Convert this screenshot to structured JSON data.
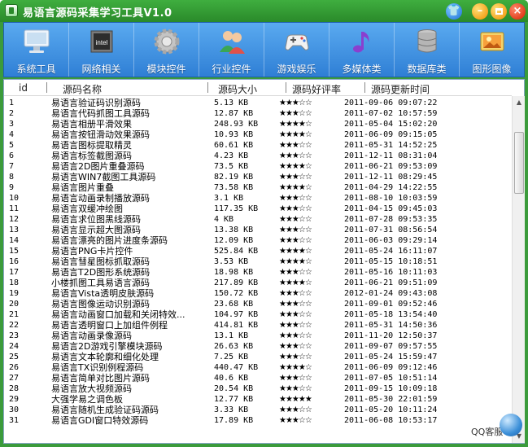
{
  "window": {
    "title": "易语言源码采集学习工具V1.0"
  },
  "colors": {
    "titlebar": "#2f9a2f",
    "toolbar": "#3a8ae0",
    "star": "#000000"
  },
  "toolbar": {
    "items": [
      {
        "label": "系统工具",
        "icon": "monitor-icon"
      },
      {
        "label": "网络相关",
        "icon": "intel-chip-icon"
      },
      {
        "label": "模块控件",
        "icon": "gear-icon"
      },
      {
        "label": "行业控件",
        "icon": "users-icon"
      },
      {
        "label": "游戏娱乐",
        "icon": "gamepad-icon"
      },
      {
        "label": "多媒体类",
        "icon": "music-note-icon"
      },
      {
        "label": "数据库类",
        "icon": "database-icon"
      },
      {
        "label": "图形图像",
        "icon": "image-icon"
      }
    ]
  },
  "table": {
    "headers": [
      "id",
      "源码名称",
      "源码大小",
      "源码好评率",
      "源码更新时间"
    ],
    "rows": [
      {
        "id": "1",
        "name": "易语言验证码识别源码",
        "size": "5.13 KB",
        "stars": 3,
        "date": "2011-09-06 09:07:22"
      },
      {
        "id": "2",
        "name": "易语言代码抓图工具源码",
        "size": "12.87 KB",
        "stars": 3,
        "date": "2011-07-02 10:57:59"
      },
      {
        "id": "3",
        "name": "易语言相册平滑效果",
        "size": "248.93 KB",
        "stars": 4,
        "date": "2011-05-04 15:02:20"
      },
      {
        "id": "4",
        "name": "易语言按钮滑动效果源码",
        "size": "10.93 KB",
        "stars": 4,
        "date": "2011-06-09 09:15:05"
      },
      {
        "id": "5",
        "name": "易语言图标提取精灵",
        "size": "60.61 KB",
        "stars": 3,
        "date": "2011-05-31 14:52:25"
      },
      {
        "id": "6",
        "name": "易语言标签截图源码",
        "size": "4.23 KB",
        "stars": 3,
        "date": "2011-12-11 08:31:04"
      },
      {
        "id": "7",
        "name": "易语言2D图片重叠源码",
        "size": "73.5 KB",
        "stars": 4,
        "date": "2011-06-21 09:53:09"
      },
      {
        "id": "8",
        "name": "易语言WIN7截图工具源码",
        "size": "82.19 KB",
        "stars": 3,
        "date": "2011-12-11 08:29:45"
      },
      {
        "id": "9",
        "name": "易语言图片重叠",
        "size": "73.58 KB",
        "stars": 4,
        "date": "2011-04-29 14:22:55"
      },
      {
        "id": "10",
        "name": "易语言动画录制播放源码",
        "size": "3.1 KB",
        "stars": 3,
        "date": "2011-08-10 10:03:59"
      },
      {
        "id": "11",
        "name": "易语言双缓冲绘图",
        "size": "117.35 KB",
        "stars": 3,
        "date": "2011-04-15 09:45:03"
      },
      {
        "id": "12",
        "name": "易语言求位图黑线源码",
        "size": "4 KB",
        "stars": 3,
        "date": "2011-07-28 09:53:35"
      },
      {
        "id": "13",
        "name": "易语言显示超大图源码",
        "size": "13.38 KB",
        "stars": 3,
        "date": "2011-07-31 08:56:54"
      },
      {
        "id": "14",
        "name": "易语言漂亮的图片进度条源码",
        "size": "12.09 KB",
        "stars": 3,
        "date": "2011-06-03 09:29:14"
      },
      {
        "id": "15",
        "name": "易语言PNG卡片控件",
        "size": "525.84 KB",
        "stars": 4,
        "date": "2011-05-24 16:11:07"
      },
      {
        "id": "16",
        "name": "易语言彗星图标抓取源码",
        "size": "3.53 KB",
        "stars": 4,
        "date": "2011-05-15 10:18:51"
      },
      {
        "id": "17",
        "name": "易语言T2D图形系统源码",
        "size": "18.98 KB",
        "stars": 3,
        "date": "2011-05-16 10:11:03"
      },
      {
        "id": "18",
        "name": "小楼抓图工具易语言源码",
        "size": "217.89 KB",
        "stars": 4,
        "date": "2011-06-21 09:51:09"
      },
      {
        "id": "19",
        "name": "易语言Vista透明皮肤源码",
        "size": "150.72 KB",
        "stars": 3,
        "date": "2012-01-24 09:43:08"
      },
      {
        "id": "20",
        "name": "易语言图像运动识别源码",
        "size": "23.68 KB",
        "stars": 3,
        "date": "2011-09-01 09:52:46"
      },
      {
        "id": "21",
        "name": "易语言动画窗口加载和关闭特效...",
        "size": "104.97 KB",
        "stars": 3,
        "date": "2011-05-18 13:54:40"
      },
      {
        "id": "22",
        "name": "易语言透明窗口上加组件例程",
        "size": "414.81 KB",
        "stars": 3,
        "date": "2011-05-31 14:50:36"
      },
      {
        "id": "23",
        "name": "易语言动画录像源码",
        "size": "13.1 KB",
        "stars": 3,
        "date": "2011-11-20 12:50:37"
      },
      {
        "id": "24",
        "name": "易语言2D游戏引擎模块源码",
        "size": "26.63 KB",
        "stars": 3,
        "date": "2011-09-07 09:57:55"
      },
      {
        "id": "25",
        "name": "易语言文本轮廓和细化处理",
        "size": "7.25 KB",
        "stars": 3,
        "date": "2011-05-24 15:59:47"
      },
      {
        "id": "26",
        "name": "易语言TX识别例程源码",
        "size": "440.47 KB",
        "stars": 4,
        "date": "2011-06-09 09:12:46"
      },
      {
        "id": "27",
        "name": "易语言简单对比图片源码",
        "size": "40.6 KB",
        "stars": 3,
        "date": "2011-07-05 10:51:14"
      },
      {
        "id": "28",
        "name": "易语言放大视频源码",
        "size": "20.54 KB",
        "stars": 3,
        "date": "2011-09-15 10:09:18"
      },
      {
        "id": "29",
        "name": "大强学易之调色板",
        "size": "12.77 KB",
        "stars": 5,
        "date": "2011-05-30 22:01:59"
      },
      {
        "id": "30",
        "name": "易语言随机生成验证码源码",
        "size": "3.33 KB",
        "stars": 3,
        "date": "2011-05-20 10:11:24"
      },
      {
        "id": "31",
        "name": "易语言GDI窗口特效源码",
        "size": "17.89 KB",
        "stars": 3,
        "date": "2011-06-08 10:53:17"
      }
    ]
  },
  "footer": {
    "qq_label": "QQ客服"
  }
}
